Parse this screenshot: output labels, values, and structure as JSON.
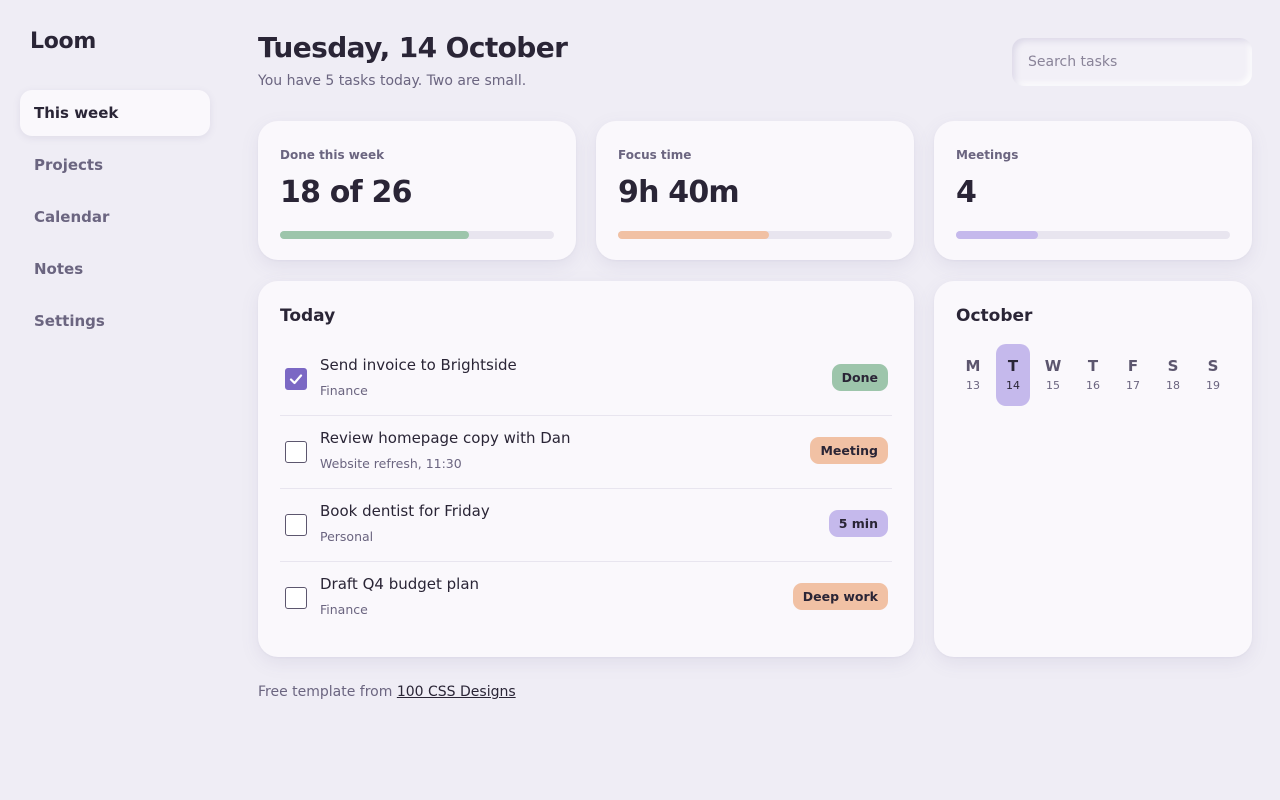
{
  "app": {
    "name": "Loom"
  },
  "sidebar": {
    "items": [
      {
        "label": "This week",
        "active": true
      },
      {
        "label": "Projects"
      },
      {
        "label": "Calendar"
      },
      {
        "label": "Notes"
      },
      {
        "label": "Settings"
      }
    ]
  },
  "header": {
    "title": "Tuesday, 14 October",
    "subtitle": "You have 5 tasks today. Two are small."
  },
  "search": {
    "placeholder": "Search tasks",
    "value": ""
  },
  "stats": [
    {
      "label": "Done this week",
      "value": "18 of 26",
      "progress": 0.69,
      "color": "#9dc5ab"
    },
    {
      "label": "Focus time",
      "value": "9h 40m",
      "progress": 0.55,
      "color": "#f1c1a4"
    },
    {
      "label": "Meetings",
      "value": "4",
      "progress": 0.3,
      "color": "#c5b9ec"
    }
  ],
  "today": {
    "title": "Today",
    "tasks": [
      {
        "title": "Send invoice to Brightside",
        "meta": "Finance",
        "badge": "Done",
        "badge_color": "#9dc5ab",
        "checked": true
      },
      {
        "title": "Review homepage copy with Dan",
        "meta": "Website refresh, 11:30",
        "badge": "Meeting",
        "badge_color": "#f1c1a4",
        "checked": false
      },
      {
        "title": "Book dentist for Friday",
        "meta": "Personal",
        "badge": "5 min",
        "badge_color": "#c5b9ec",
        "checked": false
      },
      {
        "title": "Draft Q4 budget plan",
        "meta": "Finance",
        "badge": "Deep work",
        "badge_color": "#f1c1a4",
        "checked": false
      }
    ]
  },
  "calendar": {
    "month": "October",
    "days": [
      {
        "letter": "M",
        "num": "13"
      },
      {
        "letter": "T",
        "num": "14",
        "active": true
      },
      {
        "letter": "W",
        "num": "15"
      },
      {
        "letter": "T",
        "num": "16"
      },
      {
        "letter": "F",
        "num": "17"
      },
      {
        "letter": "S",
        "num": "18"
      },
      {
        "letter": "S",
        "num": "19"
      }
    ]
  },
  "footer": {
    "text": "Free template from",
    "link_label": "100 CSS Designs"
  },
  "colors": {
    "background": "#efedf5",
    "card": "#faf8fc",
    "accent": "#7b68c4",
    "green": "#9dc5ab",
    "peach": "#f1c1a4",
    "lavender": "#c5b9ec"
  }
}
